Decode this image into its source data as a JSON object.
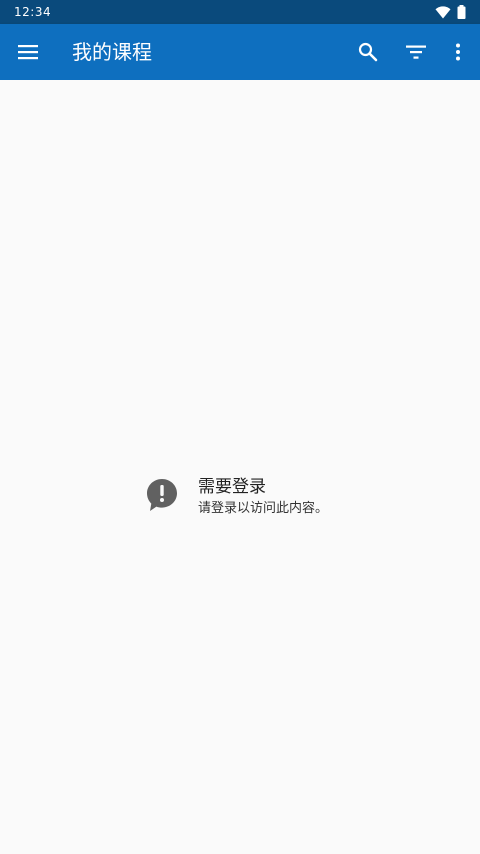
{
  "status_bar": {
    "time": "12:34",
    "icons": [
      "wifi-icon",
      "battery-icon"
    ]
  },
  "app_bar": {
    "title": "我的课程",
    "icons": [
      "menu-icon",
      "search-icon",
      "filter-icon",
      "more-vert-icon"
    ]
  },
  "empty_state": {
    "icon": "alert-speech-bubble-icon",
    "title": "需要登录",
    "message": "请登录以访问此内容。"
  },
  "colors": {
    "status_bar_bg": "#0a4a7c",
    "app_bar_bg": "#0e6fbf",
    "page_bg": "#fafafa",
    "icon_gray": "#616161"
  }
}
